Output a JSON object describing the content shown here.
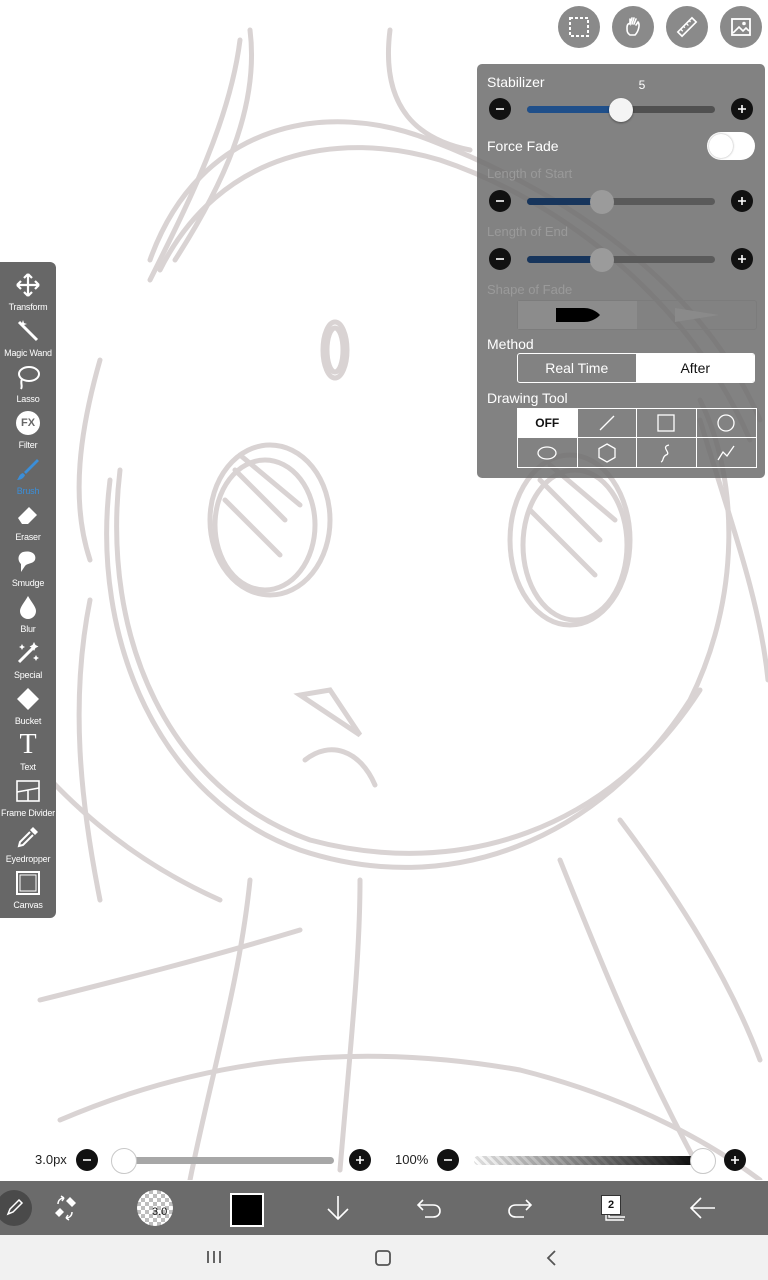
{
  "toolbar": {
    "tools": [
      {
        "label": "Transform",
        "icon": "move-arrows-icon"
      },
      {
        "label": "Magic Wand",
        "icon": "magic-wand-icon"
      },
      {
        "label": "Lasso",
        "icon": "lasso-icon"
      },
      {
        "label": "Filter",
        "icon": "fx-icon",
        "icon_text": "FX"
      },
      {
        "label": "Brush",
        "icon": "brush-icon",
        "active": true
      },
      {
        "label": "Eraser",
        "icon": "eraser-icon"
      },
      {
        "label": "Smudge",
        "icon": "smudge-icon"
      },
      {
        "label": "Blur",
        "icon": "blur-drop-icon"
      },
      {
        "label": "Special",
        "icon": "special-sparkle-icon"
      },
      {
        "label": "Bucket",
        "icon": "bucket-icon"
      },
      {
        "label": "Text",
        "icon": "text-icon",
        "icon_text": "T"
      },
      {
        "label": "Frame Divider",
        "icon": "frame-divider-icon"
      },
      {
        "label": "Eyedropper",
        "icon": "eyedropper-icon"
      },
      {
        "label": "Canvas",
        "icon": "canvas-icon"
      }
    ],
    "active_color": "#3b8ed8"
  },
  "top_buttons": [
    "selection-icon",
    "hand-stabilizer-icon",
    "ruler-icon",
    "image-layer-icon"
  ],
  "panel": {
    "stabilizer": {
      "label": "Stabilizer",
      "value": "5",
      "fraction": 0.5
    },
    "force_fade": {
      "label": "Force Fade",
      "enabled": false
    },
    "length_of_start": {
      "label": "Length of Start",
      "fraction": 0.4
    },
    "length_of_end": {
      "label": "Length of End",
      "fraction": 0.4
    },
    "shape_of_fade": {
      "label": "Shape of Fade",
      "selected": 0
    },
    "method": {
      "label": "Method",
      "options": [
        "Real Time",
        "After"
      ],
      "selected": "After"
    },
    "drawing_tool": {
      "label": "Drawing Tool",
      "off_label": "OFF",
      "cells": [
        "OFF",
        "line-icon",
        "rectangle-icon",
        "circle-icon",
        "ellipse-icon",
        "polygon-icon",
        "curve-icon",
        "polyline-icon"
      ],
      "selected": "OFF"
    }
  },
  "bottom": {
    "brush_size": "3.0px",
    "size_fraction": 0.0,
    "opacity": "100%",
    "opacity_fraction": 1.0,
    "brush_size_badge": "3.0",
    "color": "#000000",
    "layer_count": "2"
  },
  "colors": {
    "slider_blue": "#1f4f8a",
    "slider_blue_dim": "#17355c",
    "sketch_line": "#d9d3d3"
  }
}
